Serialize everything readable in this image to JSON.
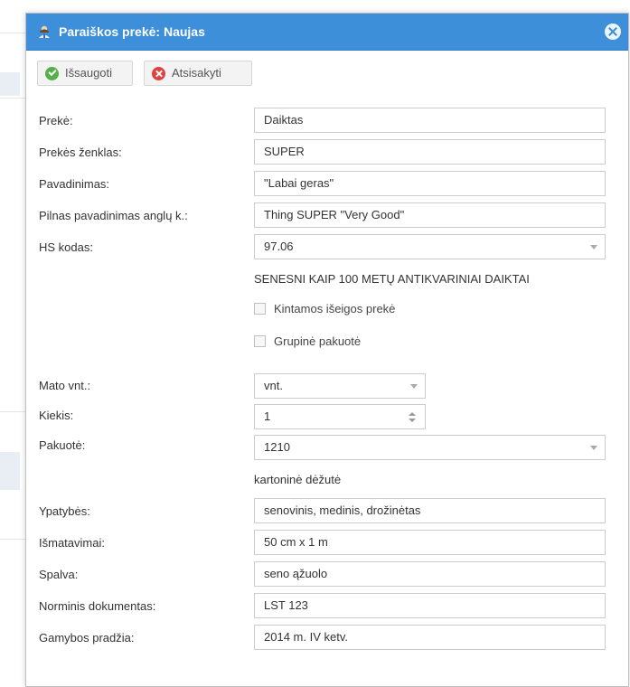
{
  "dialog": {
    "title": "Paraiškos prekė: Naujas",
    "title_icon": "user-icon",
    "close_icon": "close-icon"
  },
  "toolbar": {
    "save_label": "Išsaugoti",
    "cancel_label": "Atsisakyti"
  },
  "form": {
    "preke": {
      "label": "Prekė:",
      "value": "Daiktas"
    },
    "zenklas": {
      "label": "Prekės ženklas:",
      "value": "SUPER"
    },
    "pavadinimas": {
      "label": "Pavadinimas:",
      "value": "\"Labai geras\""
    },
    "pilnas": {
      "label": "Pilnas pavadinimas anglų k.:",
      "value": "Thing SUPER \"Very Good\""
    },
    "hs": {
      "label": "HS kodas:",
      "value": "97.06",
      "description": "SENESNI KAIP 100 METŲ ANTIKVARINIAI DAIKTAI"
    },
    "kintamos": {
      "label": "Kintamos išeigos prekė",
      "checked": false
    },
    "grupine": {
      "label": "Grupinė pakuotė",
      "checked": false
    },
    "mato": {
      "label": "Mato vnt.:",
      "value": "vnt."
    },
    "kiekis": {
      "label": "Kiekis:",
      "value": "1"
    },
    "pakuote": {
      "label": "Pakuotė:",
      "value": "1210",
      "description": "kartoninė dėžutė"
    },
    "ypatybes": {
      "label": "Ypatybės:",
      "value": "senovinis, medinis, drožinėtas"
    },
    "ismatavimai": {
      "label": "Išmatavimai:",
      "value": "50 cm x 1 m"
    },
    "spalva": {
      "label": "Spalva:",
      "value": "seno ąžuolo"
    },
    "norminis": {
      "label": "Norminis dokumentas:",
      "value": "LST 123"
    },
    "gamybos": {
      "label": "Gamybos pradžia:",
      "value": "2014 m. IV ketv."
    }
  },
  "colors": {
    "titlebar": "#3c8fd8",
    "save_icon": "#55b04a",
    "cancel_icon": "#e04040"
  }
}
